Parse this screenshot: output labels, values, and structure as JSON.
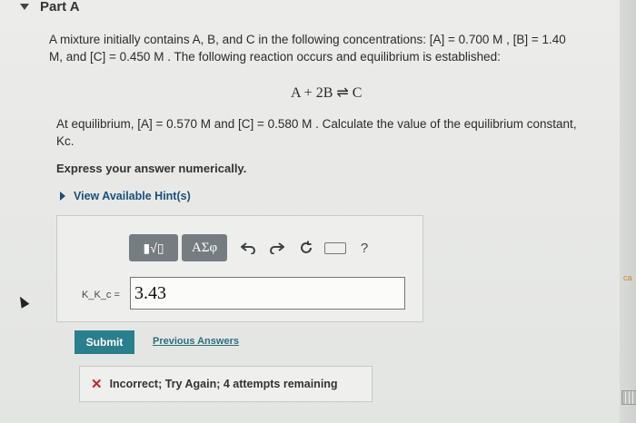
{
  "part": {
    "title": "Part A"
  },
  "problem": {
    "line1": "A mixture initially contains A, B, and C in the following concentrations: [A] = 0.700 M , [B] = 1.40",
    "line2": "M, and [C] = 0.450 M . The following reaction occurs and equilibrium is established:",
    "equation": "A + 2B ⇌ C",
    "line3": "At equilibrium, [A] = 0.570 M and [C] = 0.580 M . Calculate the value of the equilibrium constant,",
    "line4": "Kc."
  },
  "instruction": "Express your answer numerically.",
  "hints_label": "View Available Hint(s)",
  "toolbar": {
    "templates_label": "▮√▯",
    "greek_label": "ΑΣφ",
    "help_label": "?"
  },
  "answer": {
    "label": "K_K_c =",
    "value": "3.43"
  },
  "buttons": {
    "submit": "Submit",
    "previous": "Previous Answers"
  },
  "feedback": {
    "icon": "✕",
    "text": "Incorrect; Try Again; 4 attempts remaining"
  },
  "edge_label": "ca",
  "colors": {
    "submit": "#2a7f8c",
    "error": "#c8262c",
    "link": "#1a4f7a"
  }
}
